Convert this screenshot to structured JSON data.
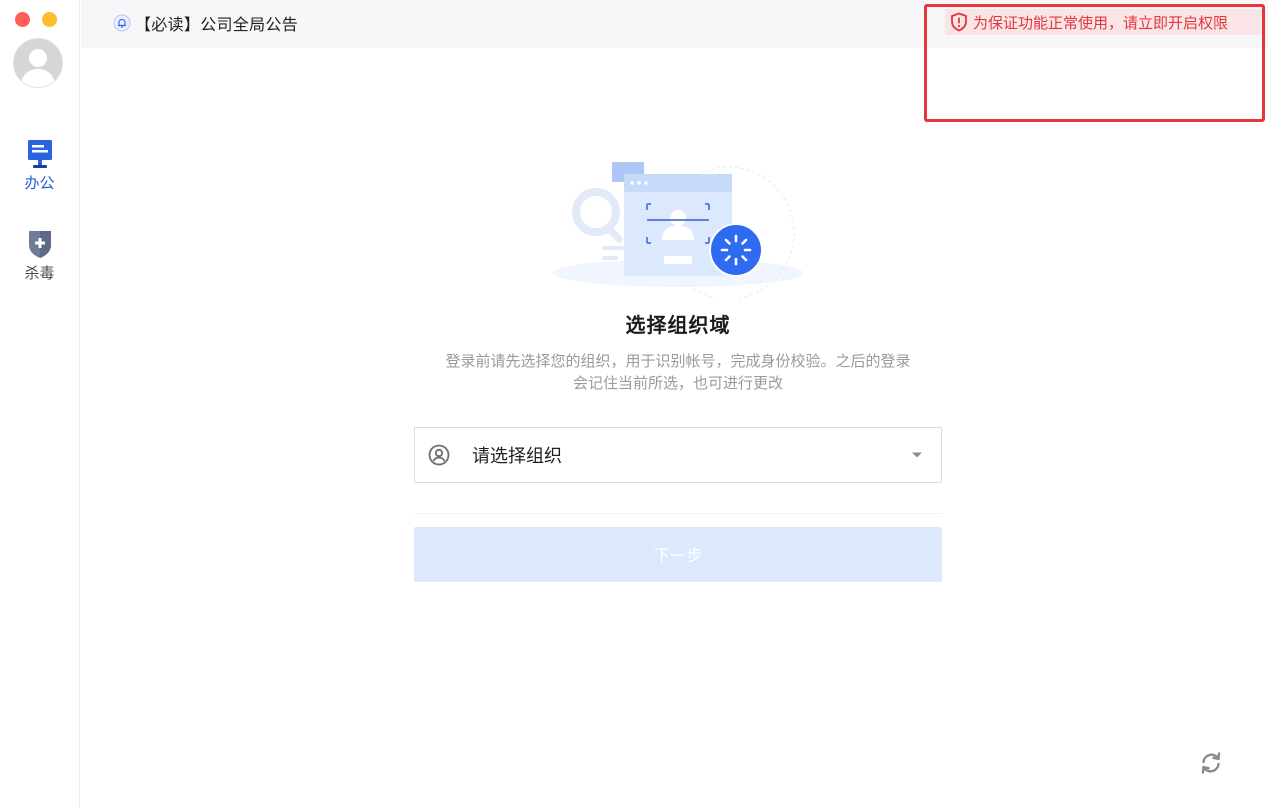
{
  "window": {
    "controls": [
      "close",
      "minimize"
    ]
  },
  "sidebar": {
    "avatar_icon": "user-avatar-icon",
    "items": [
      {
        "label": "办公",
        "icon": "office-desktop-icon",
        "active": true,
        "color": "#1f5fd6"
      },
      {
        "label": "杀毒",
        "icon": "antivirus-shield-icon",
        "active": false,
        "color": "#4a4a4a"
      }
    ]
  },
  "topbar": {
    "announcement_icon": "bell-icon",
    "announcement": "【必读】公司全局公告"
  },
  "permission_warning": {
    "icon": "shield-alert-icon",
    "text": "为保证功能正常使用，请立即开启权限",
    "color": "#e0383f",
    "highlight_border": "#e8353c"
  },
  "main": {
    "illustration_icon": "org-scan-loading-illustration",
    "title": "选择组织域",
    "description_line1": "登录前请先选择您的组织，用于识别帐号，完成身份校验。之后的登录",
    "description_line2": "会记住当前所选，也可进行更改",
    "select": {
      "icon": "user-circle-icon",
      "placeholder": "请选择组织",
      "caret_icon": "caret-down-icon"
    },
    "next_button": {
      "label": "下一步",
      "enabled": false
    }
  },
  "footer": {
    "refresh_icon": "refresh-icon"
  },
  "colors": {
    "accent": "#2f6bf0",
    "button_disabled_bg": "#dce8fb",
    "topbar_bg": "#f7f7f9"
  }
}
